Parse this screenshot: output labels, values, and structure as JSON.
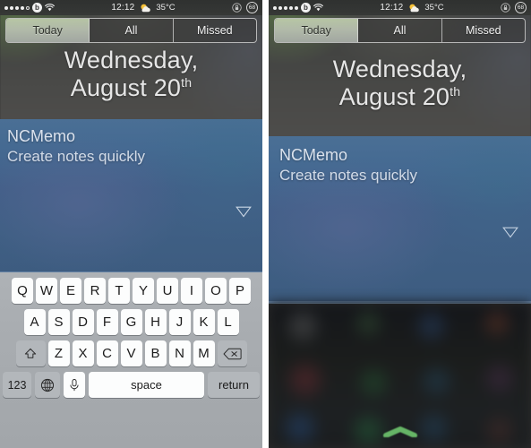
{
  "screens": [
    {
      "id": "left",
      "name": "notification-center-with-keyboard",
      "status_bar": {
        "signal_dots_filled": 4,
        "signal_dots_total": 5,
        "carrier_icon": "beats-b-circle-icon",
        "carrier_label": "b",
        "wifi_icon": "wifi-icon",
        "time": "12:12",
        "weather_icon": "sun-behind-cloud-icon",
        "temperature": "35°C",
        "rotation_lock_icon": "rotation-lock-icon",
        "battery_icon": "battery-circle-icon",
        "battery_percent": "68"
      },
      "tabs": [
        {
          "label": "Today",
          "active": true
        },
        {
          "label": "All",
          "active": false
        },
        {
          "label": "Missed",
          "active": false
        }
      ],
      "date": {
        "line1": "Wednesday,",
        "line2_month_day": "August 20",
        "ordinal": "th"
      },
      "widget": {
        "title": "NCMemo",
        "subtitle": "Create notes quickly",
        "expand_icon": "triangle-down-icon"
      },
      "keyboard": {
        "visible": true,
        "row1": [
          "Q",
          "W",
          "E",
          "R",
          "T",
          "Y",
          "U",
          "I",
          "O",
          "P"
        ],
        "row2": [
          "A",
          "S",
          "D",
          "F",
          "G",
          "H",
          "J",
          "K",
          "L"
        ],
        "row3_letters": [
          "Z",
          "X",
          "C",
          "V",
          "B",
          "N",
          "M"
        ],
        "shift_icon": "shift-up-arrow-icon",
        "delete_icon": "backspace-delete-icon",
        "numbers_label": "123",
        "globe_icon": "globe-language-icon",
        "mic_icon": "microphone-icon",
        "space_label": "space",
        "return_label": "return"
      },
      "grabber": {
        "visible": false,
        "icon": "home-grabber-chevron-icon"
      }
    },
    {
      "id": "right",
      "name": "notification-center-over-home-screen",
      "status_bar": {
        "signal_dots_filled": 5,
        "signal_dots_total": 5,
        "carrier_icon": "beats-b-circle-icon",
        "carrier_label": "b",
        "wifi_icon": "wifi-icon",
        "time": "12:12",
        "weather_icon": "sun-behind-cloud-icon",
        "temperature": "35°C",
        "rotation_lock_icon": "rotation-lock-icon",
        "battery_icon": "battery-circle-icon",
        "battery_percent": "68"
      },
      "tabs": [
        {
          "label": "Today",
          "active": true
        },
        {
          "label": "All",
          "active": false
        },
        {
          "label": "Missed",
          "active": false
        }
      ],
      "date": {
        "line1": "Wednesday,",
        "line2_month_day": "August 20",
        "ordinal": "th"
      },
      "widget": {
        "title": "NCMemo",
        "subtitle": "Create notes quickly",
        "expand_icon": "triangle-down-icon"
      },
      "keyboard": {
        "visible": false
      },
      "grabber": {
        "visible": true,
        "icon": "home-grabber-chevron-icon"
      }
    }
  ],
  "colors": {
    "widget_panel_blue": "#42638c",
    "tab_active_bg": "#c6d6b2",
    "keyboard_bg": "#a9adb1",
    "key_face": "#fcfdfd",
    "grabber_green": "#5fae62",
    "status_text": "#ececec"
  }
}
